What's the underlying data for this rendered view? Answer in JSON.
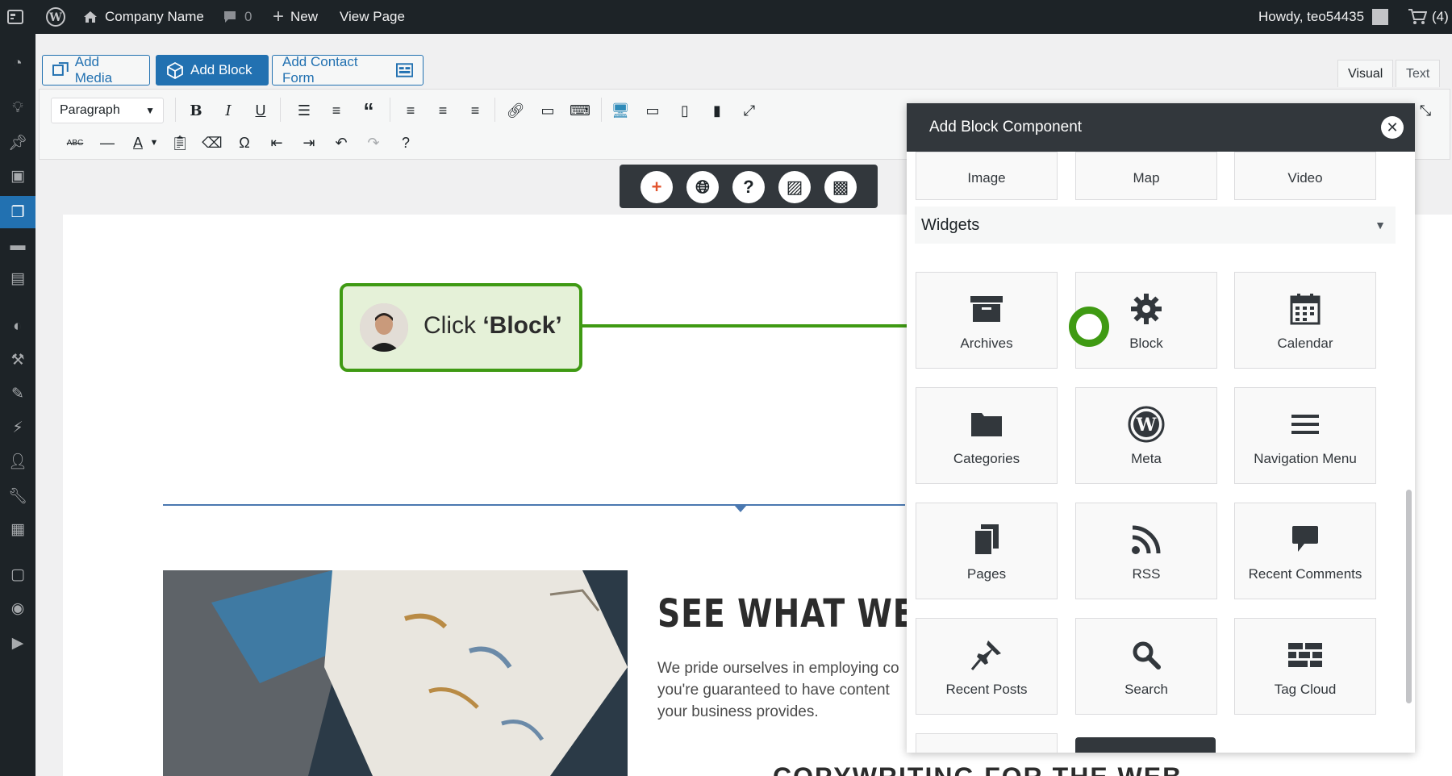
{
  "adminbar": {
    "site_name": "Company Name",
    "comments_count": "0",
    "new_label": "New",
    "view_page_label": "View Page",
    "greeting": "Howdy, teo54435",
    "cart_count": "(4)"
  },
  "editor": {
    "buttons": {
      "add_media": "Add Media",
      "add_block": "Add Block",
      "add_contact_form": "Add Contact Form"
    },
    "tabs": {
      "visual": "Visual",
      "text": "Text"
    },
    "format_select": "Paragraph"
  },
  "content": {
    "heading": "SEE WHAT WE OF",
    "body_text": "We pride ourselves in employing co\nyou're guaranteed to have content\nyour business provides.",
    "subheading": "COPYWRITING FOR THE WEB"
  },
  "callout": {
    "prefix": "Click ",
    "target": "‘Block’"
  },
  "panel": {
    "title": "Add Block Component",
    "top_tiles": [
      "Image",
      "Map",
      "Video"
    ],
    "section_title": "Widgets",
    "widgets": [
      {
        "label": "Archives",
        "icon": "archive-icon"
      },
      {
        "label": "Block",
        "icon": "gear-icon"
      },
      {
        "label": "Calendar",
        "icon": "calendar-icon"
      },
      {
        "label": "Categories",
        "icon": "folder-icon"
      },
      {
        "label": "Meta",
        "icon": "wordpress-icon"
      },
      {
        "label": "Navigation Menu",
        "icon": "menu-icon"
      },
      {
        "label": "Pages",
        "icon": "pages-icon"
      },
      {
        "label": "RSS",
        "icon": "rss-icon"
      },
      {
        "label": "Recent Comments",
        "icon": "comment-icon"
      },
      {
        "label": "Recent Posts",
        "icon": "pin-icon"
      },
      {
        "label": "Search",
        "icon": "search-icon"
      },
      {
        "label": "Tag Cloud",
        "icon": "tag-cloud-icon"
      }
    ]
  },
  "colors": {
    "admin_dark": "#1d2327",
    "wp_blue": "#2271b1",
    "callout_green": "#3f9a13",
    "callout_fill": "#e5f1d8",
    "panel_header": "#32373c"
  }
}
